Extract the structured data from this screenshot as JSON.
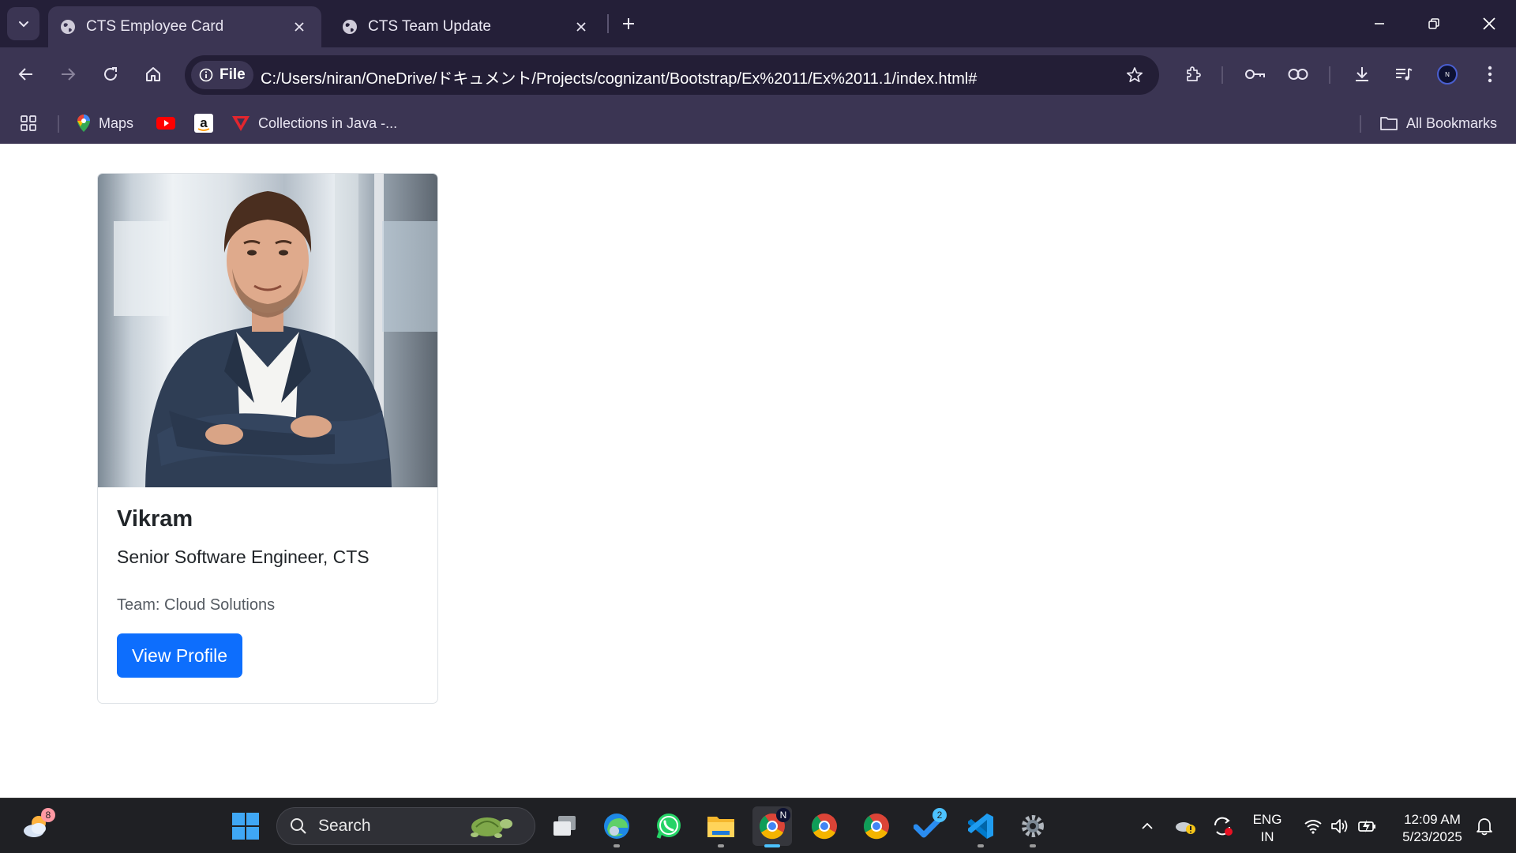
{
  "browser": {
    "tabs": [
      {
        "title": "CTS Employee Card",
        "active": true
      },
      {
        "title": "CTS Team Update",
        "active": false
      }
    ],
    "address": {
      "scheme_label": "File",
      "url": "C:/Users/niran/OneDrive/ドキュメント/Projects/cognizant/Bootstrap/Ex%2011/Ex%2011.1/index.html#"
    },
    "bookmarks": [
      {
        "label": "Maps",
        "icon": "maps-icon"
      },
      {
        "label": "",
        "icon": "youtube-icon"
      },
      {
        "label": "",
        "icon": "amazon-icon"
      },
      {
        "label": "Collections in Java -...",
        "icon": "tutorial-site-icon"
      }
    ],
    "all_bookmarks_label": "All Bookmarks",
    "profile_initial": "N"
  },
  "card": {
    "name": "Vikram",
    "role": "Senior Software Engineer, CTS",
    "team": "Team: Cloud Solutions",
    "button_label": "View Profile",
    "button_color": "#0d6efd"
  },
  "taskbar": {
    "search_placeholder": "Search",
    "widgets_badge": "8",
    "todo_badge": "2",
    "language_line1": "ENG",
    "language_line2": "IN",
    "time": "12:09 AM",
    "date": "5/23/2025"
  },
  "colors": {
    "tabstrip": "#241f38",
    "toolbar": "#3b3553",
    "taskbar": "#1f2024",
    "accent": "#4cc2ff"
  }
}
